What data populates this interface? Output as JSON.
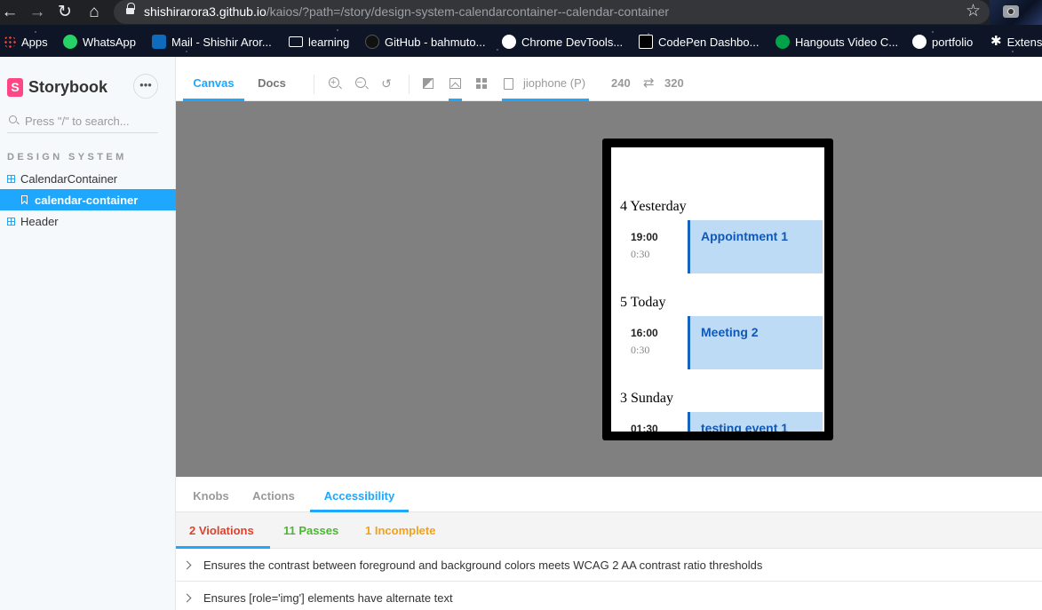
{
  "browser": {
    "url_host": "shishirarora3.github.io",
    "url_path": "/kaios/?path=/story/design-system-calendarcontainer--calendar-container",
    "bookmarks": [
      "Apps",
      "WhatsApp",
      "Mail - Shishir Aror...",
      "learning",
      "GitHub - bahmuto...",
      "Chrome DevTools...",
      "CodePen Dashbo...",
      "Hangouts Video C...",
      "portfolio",
      "Extens"
    ]
  },
  "sidebar": {
    "brand": "Storybook",
    "search_placeholder": "Press \"/\" to search...",
    "section_title": "DESIGN SYSTEM",
    "items": [
      {
        "label": "CalendarContainer",
        "type": "component"
      },
      {
        "label": "calendar-container",
        "type": "story",
        "active": true
      },
      {
        "label": "Header",
        "type": "component"
      }
    ]
  },
  "toolbar": {
    "tabs": [
      "Canvas",
      "Docs"
    ],
    "active_tab": "Canvas",
    "device": "jiophone (P)",
    "width": "240",
    "height": "320",
    "swap_symbol": "⇄"
  },
  "preview": {
    "days": [
      {
        "header": "4 Yesterday",
        "event": {
          "time": "19:00",
          "duration": "0:30",
          "title": "Appointment 1"
        }
      },
      {
        "header": "5 Today",
        "event": {
          "time": "16:00",
          "duration": "0:30",
          "title": "Meeting 2"
        }
      },
      {
        "header": "3 Sunday",
        "event": {
          "time": "01:30",
          "duration": "",
          "title": "testing event 1"
        }
      }
    ]
  },
  "addons": {
    "tabs": [
      "Knobs",
      "Actions",
      "Accessibility"
    ],
    "active_tab": "Accessibility",
    "results": [
      {
        "label": "2 Violations",
        "color": "#e0412a"
      },
      {
        "label": "11 Passes",
        "color": "#4db535"
      },
      {
        "label": "1 Incomplete",
        "color": "#f0a21b"
      }
    ],
    "violations": [
      "Ensures the contrast between foreground and background colors meets WCAG 2 AA contrast ratio thresholds",
      "Ensures [role='img'] elements have alternate text"
    ]
  },
  "colors": {
    "accent": "#1ea7fd",
    "brand": "#ff4785",
    "canvas_bg": "#808080",
    "event_card": "#bedbf5",
    "event_border": "#1565c0"
  }
}
